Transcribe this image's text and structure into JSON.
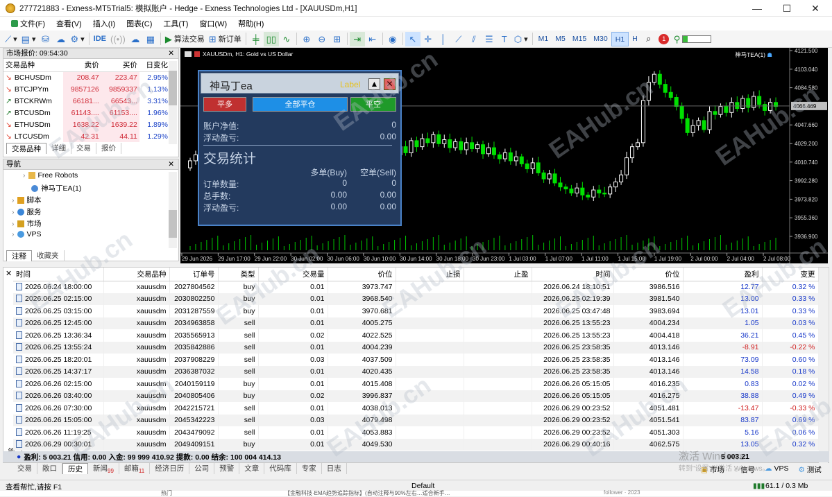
{
  "window": {
    "title": "277721883 - Exness-MT5Trial5: 模拟账户 - Hedge - Exness Technologies Ltd - [XAUUSDm,H1]",
    "minimize": "—",
    "maximize": "☐",
    "close": "✕"
  },
  "menu": [
    "文件(F)",
    "查看(V)",
    "插入(I)",
    "图表(C)",
    "工具(T)",
    "窗口(W)",
    "帮助(H)"
  ],
  "toolbar": {
    "ide": "IDE",
    "algo_trading": "算法交易",
    "new_order": "新订单",
    "timeframes": [
      "M1",
      "M5",
      "M15",
      "M30",
      "H1",
      "H"
    ],
    "active_timeframe": "H1",
    "notification_count": "1"
  },
  "market_watch": {
    "title": "市场报价: 09:54:30",
    "headers": [
      "交易品种",
      "卖价",
      "买价",
      "日变化"
    ],
    "rows": [
      {
        "symbol": "BCHUSDm",
        "bid": "208.47",
        "ask": "223.47",
        "change": "2.95%",
        "dir": "down"
      },
      {
        "symbol": "BTCJPYm",
        "bid": "9857126",
        "ask": "9859337",
        "change": "1.13%",
        "dir": "down"
      },
      {
        "symbol": "BTCKRWm",
        "bid": "66181...",
        "ask": "66543...",
        "change": "3.31%",
        "dir": "up"
      },
      {
        "symbol": "BTCUSDm",
        "bid": "61143....",
        "ask": "61153....",
        "change": "1.96%",
        "dir": "up"
      },
      {
        "symbol": "ETHUSDm",
        "bid": "1638.22",
        "ask": "1639.22",
        "change": "1.89%",
        "dir": "down"
      },
      {
        "symbol": "LTCUSDm",
        "bid": "42.31",
        "ask": "44.11",
        "change": "1.29%",
        "dir": "down"
      }
    ],
    "tabs": [
      "交易品种",
      "详细",
      "交易",
      "报价"
    ]
  },
  "navigator": {
    "title": "导航",
    "items": [
      "Free Robots",
      "神马丁EA(1)",
      "脚本",
      "服务",
      "市场",
      "VPS"
    ],
    "tabs": [
      "注释",
      "收藏夹"
    ]
  },
  "chart": {
    "symbol_label": "XAUUSDm, H1:  Gold vs US Dollar",
    "ea_label": "神马TEA(1)",
    "price_labels": [
      "4121.500",
      "4103.040",
      "4084.580",
      "4066.469",
      "4047.660",
      "4029.200",
      "4010.740",
      "3992.280",
      "3973.820",
      "3955.360",
      "3936.900"
    ],
    "current_price": "4066.469",
    "time_labels": [
      "29 Jun 2026",
      "29 Jun 17:00",
      "29 Jun 22:00",
      "30 Jun 02:00",
      "30 Jun 06:00",
      "30 Jun 10:00",
      "30 Jun 14:00",
      "30 Jun 18:00",
      "30 Jun 23:00",
      "1 Jul 03:00",
      "1 Jul 07:00",
      "1 Jul 11:00",
      "1 Jul 15:00",
      "1 Jul 19:00",
      "2 Jul 00:00",
      "2 Jul 04:00",
      "2 Jul 08:00"
    ]
  },
  "ea_panel": {
    "name": "神马丁ea",
    "label": "Label",
    "btn_close_buy": "平多",
    "btn_close_all": "全部平仓",
    "btn_close_sell": "平空",
    "equity_label": "账户净值:",
    "equity_value": "0",
    "float_label": "浮动盈亏:",
    "float_value": "0.00",
    "stats_title": "交易统计",
    "col_buy": "多单(Buy)",
    "col_sell": "空单(Sell)",
    "rows": [
      {
        "label": "订单数量:",
        "buy": "0",
        "sell": "0"
      },
      {
        "label": "总手数:",
        "buy": "0.00",
        "sell": "0.00"
      },
      {
        "label": "浮动盈亏:",
        "buy": "0.00",
        "sell": "0.00"
      }
    ]
  },
  "terminal": {
    "headers": [
      "时间",
      "交易品种",
      "订单号",
      "类型",
      "交易量",
      "价位",
      "止损",
      "止盈",
      "时间",
      "价位",
      "盈利",
      "变更"
    ],
    "rows": [
      [
        "2026.06.24 18:00:00",
        "xauusdm",
        "2027804562",
        "buy",
        "0.01",
        "3973.747",
        "",
        "",
        "2026.06.24 18:10:51",
        "3986.516",
        "12.77",
        "0.32 %"
      ],
      [
        "2026.06.25 02:15:00",
        "xauusdm",
        "2030802250",
        "buy",
        "0.01",
        "3968.540",
        "",
        "",
        "2026.06.25 02:19:39",
        "3981.540",
        "13.00",
        "0.33 %"
      ],
      [
        "2026.06.25 03:15:00",
        "xauusdm",
        "2031287559",
        "buy",
        "0.01",
        "3970.681",
        "",
        "",
        "2026.06.25 03:47:48",
        "3983.694",
        "13.01",
        "0.33 %"
      ],
      [
        "2026.06.25 12:45:00",
        "xauusdm",
        "2034963858",
        "sell",
        "0.01",
        "4005.275",
        "",
        "",
        "2026.06.25 13:55:23",
        "4004.234",
        "1.05",
        "0.03 %"
      ],
      [
        "2026.06.25 13:36:34",
        "xauusdm",
        "2035565913",
        "sell",
        "0.02",
        "4022.525",
        "",
        "",
        "2026.06.25 13:55:23",
        "4004.418",
        "36.21",
        "0.45 %"
      ],
      [
        "2026.06.25 13:55:24",
        "xauusdm",
        "2035842886",
        "sell",
        "0.01",
        "4004.239",
        "",
        "",
        "2026.06.25 23:58:35",
        "4013.146",
        "-8.91",
        "-0.22 %"
      ],
      [
        "2026.06.25 18:20:01",
        "xauusdm",
        "2037908229",
        "sell",
        "0.03",
        "4037.509",
        "",
        "",
        "2026.06.25 23:58:35",
        "4013.146",
        "73.09",
        "0.60 %"
      ],
      [
        "2026.06.25 14:37:17",
        "xauusdm",
        "2036387032",
        "sell",
        "0.01",
        "4020.435",
        "",
        "",
        "2026.06.25 23:58:35",
        "4013.146",
        "14.58",
        "0.18 %"
      ],
      [
        "2026.06.26 02:15:00",
        "xauusdm",
        "2040159119",
        "buy",
        "0.01",
        "4015.408",
        "",
        "",
        "2026.06.26 05:15:05",
        "4016.235",
        "0.83",
        "0.02 %"
      ],
      [
        "2026.06.26 03:40:00",
        "xauusdm",
        "2040805406",
        "buy",
        "0.02",
        "3996.837",
        "",
        "",
        "2026.06.26 05:15:05",
        "4016.275",
        "38.88",
        "0.49 %"
      ],
      [
        "2026.06.26 07:30:00",
        "xauusdm",
        "2042215721",
        "sell",
        "0.01",
        "4038.013",
        "",
        "",
        "2026.06.29 00:23:52",
        "4051.481",
        "-13.47",
        "-0.33 %"
      ],
      [
        "2026.06.26 15:05:00",
        "xauusdm",
        "2045342223",
        "sell",
        "0.03",
        "4079.498",
        "",
        "",
        "2026.06.29 00:23:52",
        "4051.541",
        "83.87",
        "0.69 %"
      ],
      [
        "2026.06.26 11:19:25",
        "xauusdm",
        "2043479092",
        "sell",
        "0.01",
        "4053.883",
        "",
        "",
        "2026.06.29 00:23:52",
        "4051.303",
        "5.16",
        "0.06 %"
      ],
      [
        "2026.06.29 00:30:01",
        "xauusdm",
        "2049409151",
        "buy",
        "0.01",
        "4049.530",
        "",
        "",
        "2026.06.29 00:40:16",
        "4062.575",
        "13.05",
        "0.32 %"
      ]
    ],
    "summary": "盈利: 5 003.21  信用: 0.00  入金: 99 999 410.92  提款: 0.00  结余: 100 004 414.13",
    "summary_total": "5 003.21",
    "tabs": [
      "交易",
      "敞口",
      "历史",
      "新闻",
      "邮箱",
      "经济日历",
      "公司",
      "预警",
      "文章",
      "代码库",
      "专家",
      "日志"
    ],
    "news_badge": "99",
    "mail_badge": "11",
    "active_tab": "历史",
    "side_label": "工具箱",
    "right_tabs": [
      "市场",
      "信号",
      "VPS",
      "测试"
    ]
  },
  "status": {
    "left": "查看帮忙,请按 F1",
    "profile": "Default",
    "connection": "61.1 / 0.3 Mb"
  },
  "watermark": "EAHub.cn",
  "activation": "激活 Windows",
  "activation_sub": "转到\"设置\"以激活 Windows。",
  "taskbar_left": "热门",
  "taskbar_mid": "【金融科技·EMA趋势追踪指标】(自动注释与90%左右…适合新手…",
  "taskbar_right": "follower · 2023",
  "colors": {
    "bull": "#ffffff",
    "bear": "#00e000",
    "profit": "#1536c9",
    "loss": "#d01f1f"
  }
}
